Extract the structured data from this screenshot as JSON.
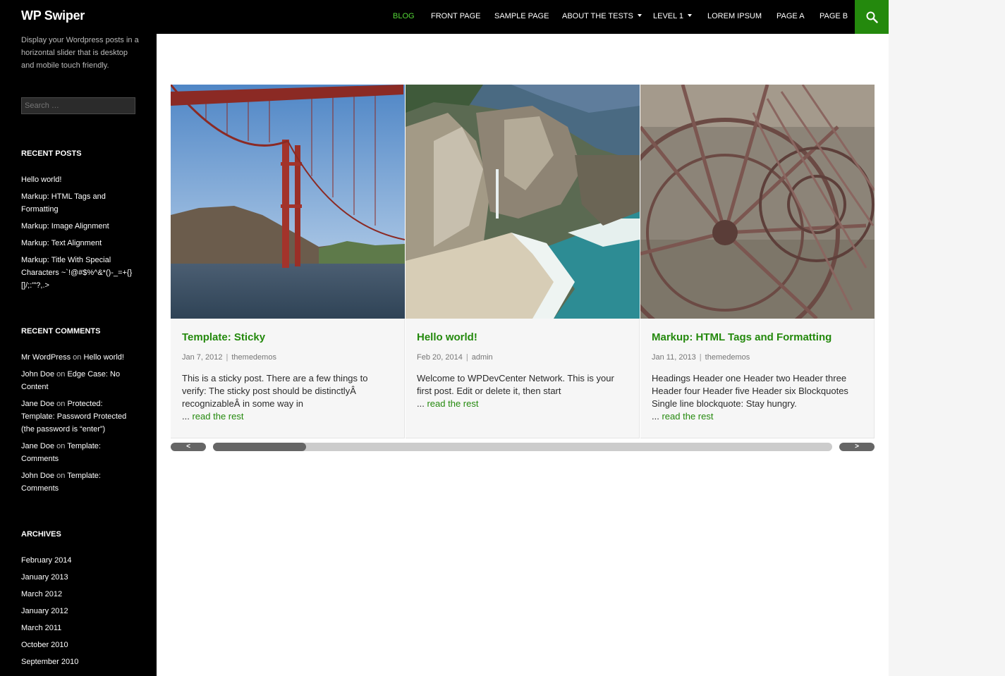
{
  "header": {
    "site_title": "WP Swiper",
    "nav": [
      {
        "label": "BLOG",
        "active": true,
        "dropdown": false
      },
      {
        "label": "FRONT PAGE",
        "active": false,
        "dropdown": false
      },
      {
        "label": "SAMPLE PAGE",
        "active": false,
        "dropdown": false
      },
      {
        "label": "ABOUT THE TESTS",
        "active": false,
        "dropdown": true
      },
      {
        "label": "LEVEL 1",
        "active": false,
        "dropdown": true
      },
      {
        "label": "LOREM IPSUM",
        "active": false,
        "dropdown": false
      },
      {
        "label": "PAGE A",
        "active": false,
        "dropdown": false
      },
      {
        "label": "PAGE B",
        "active": false,
        "dropdown": false
      }
    ],
    "search_icon": "search-icon"
  },
  "sidebar": {
    "tagline": "Display your Wordpress posts in a horizontal slider that is desktop and mobile touch friendly.",
    "search_placeholder": "Search …",
    "recent_posts_title": "RECENT POSTS",
    "recent_posts": [
      "Hello world!",
      "Markup: HTML Tags and Formatting",
      "Markup: Image Alignment",
      "Markup: Text Alignment",
      "Markup: Title With Special Characters ~`!@#$%^&*()-_=+{}[]/;:'\"?,.>"
    ],
    "recent_comments_title": "RECENT COMMENTS",
    "recent_comments": [
      {
        "author": "Mr WordPress",
        "on": "on",
        "post": "Hello world!"
      },
      {
        "author": "John Doe",
        "on": "on",
        "post": "Edge Case: No Content"
      },
      {
        "author": "Jane Doe",
        "on": "on",
        "post": "Protected: Template: Password Protected (the password is “enter”)"
      },
      {
        "author": "Jane Doe",
        "on": "on",
        "post": "Template: Comments"
      },
      {
        "author": "John Doe",
        "on": "on",
        "post": "Template: Comments"
      }
    ],
    "archives_title": "ARCHIVES",
    "archives": [
      "February 2014",
      "January 2013",
      "March 2012",
      "January 2012",
      "March 2011",
      "October 2010",
      "September 2010"
    ]
  },
  "slider": {
    "slides": [
      {
        "title": "Template: Sticky",
        "date": "Jan 7, 2012",
        "author": "themedemos",
        "excerpt": "This is a sticky post. There are a few things to verify: The sticky post should be distinctlyÂ recognizableÂ in some way in",
        "ellipsis": "...",
        "more": "read the rest",
        "image": "golden-gate-bridge-photo"
      },
      {
        "title": "Hello world!",
        "date": "Feb 20, 2014",
        "author": "admin",
        "excerpt": "Welcome to WPDevCenter Network. This is your first post. Edit or delete it, then start",
        "ellipsis": "...",
        "more": "read the rest",
        "image": "coastal-waterfall-beach-photo"
      },
      {
        "title": "Markup: HTML Tags and Formatting",
        "date": "Jan 11, 2013",
        "author": "themedemos",
        "excerpt": "Headings Header one Header two Header three Header four Header five Header six Blockquotes Single line blockquote: Stay hungry.",
        "ellipsis": "...",
        "more": "read the rest",
        "image": "rusty-wheels-photo"
      }
    ],
    "prev_label": "<",
    "next_label": ">",
    "scroll_position": 0.15
  },
  "colors": {
    "accent": "#24890d",
    "active_nav": "#55d737",
    "header_bg": "#000000"
  }
}
